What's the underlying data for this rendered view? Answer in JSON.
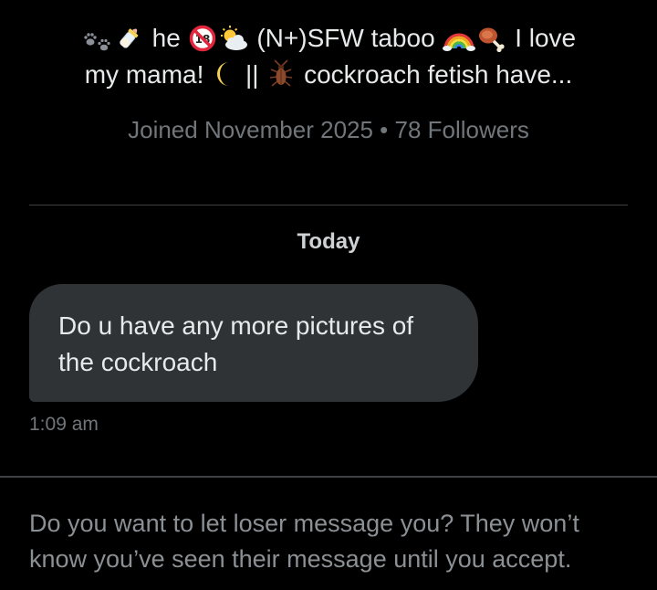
{
  "profile": {
    "bio_line1": {
      "t1": "he",
      "t2": "(N+)SFW taboo",
      "t3": "I love"
    },
    "bio_line2": {
      "t1": "my mama!",
      "t2": "||",
      "t3": "cockroach fetish have..."
    },
    "icons": [
      "paw-prints-icon",
      "baby-bottle-icon",
      "no-under-18-icon",
      "sun-behind-cloud-icon",
      "rainbow-icon",
      "meat-on-bone-icon",
      "crescent-moon-icon",
      "cockroach-icon"
    ],
    "joined_text": "Joined November 2025 • 78 Followers"
  },
  "conversation": {
    "day_label": "Today",
    "message": {
      "line1": "Do u have any more pictures of",
      "line2": "the cockroach",
      "time": "1:09 am"
    }
  },
  "request": {
    "line1": "Do you want to let loser message you? They won’t",
    "line2": "know you’ve seen their message until you accept."
  },
  "colors": {
    "background": "#000000",
    "primary_text": "#e7e9ea",
    "secondary_text": "#71767b",
    "bubble": "#2f3336",
    "divider": "#3e4144"
  }
}
